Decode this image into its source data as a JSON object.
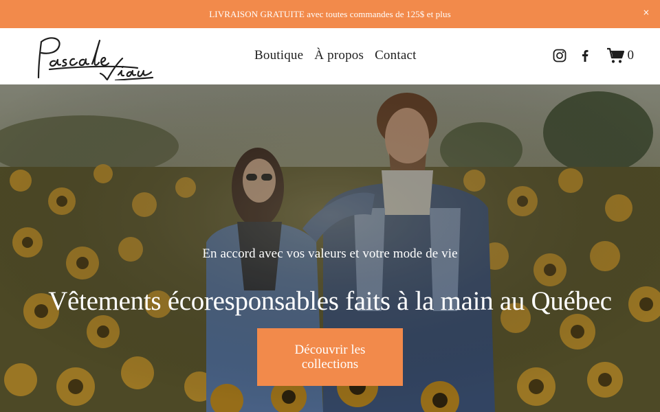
{
  "announcement": {
    "text": "LIVRAISON GRATUITE avec toutes commandes de 125$ et plus",
    "close_glyph": "×"
  },
  "brand": {
    "logo_text": "Pascale Viau"
  },
  "nav": {
    "items": [
      {
        "label": "Boutique"
      },
      {
        "label": "À propos"
      },
      {
        "label": "Contact"
      }
    ]
  },
  "social": {
    "icons": [
      "instagram-icon",
      "facebook-icon"
    ]
  },
  "cart": {
    "icon": "cart-icon",
    "count": "0"
  },
  "hero": {
    "subtitle": "En accord avec vos valeurs et votre mode de vie",
    "title": "Vêtements écoresponsables faits à la main au Québec",
    "cta_label": "Découvrir les collections"
  },
  "colors": {
    "accent": "#f28a4b",
    "text": "#1e1e1e",
    "background": "#ffffff"
  }
}
